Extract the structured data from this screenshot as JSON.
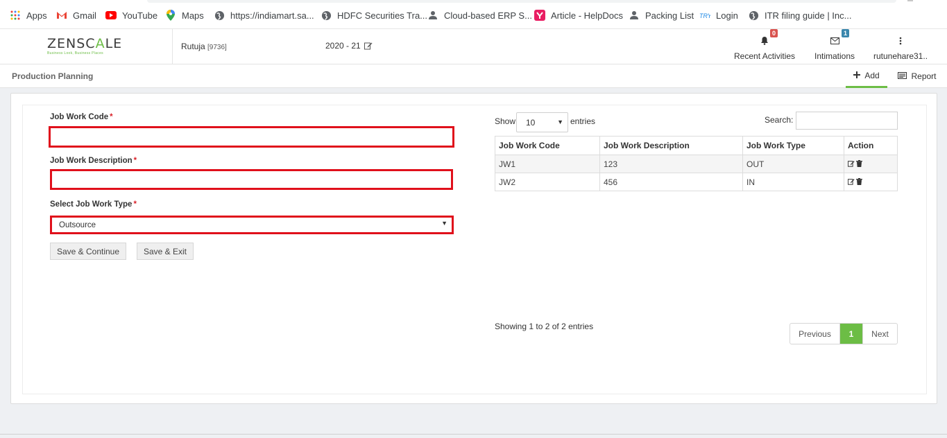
{
  "bookmarks": [
    {
      "label": "Apps",
      "icon": "apps-grid-icon"
    },
    {
      "label": "Gmail",
      "icon": "gmail-icon"
    },
    {
      "label": "YouTube",
      "icon": "youtube-icon"
    },
    {
      "label": "Maps",
      "icon": "maps-icon"
    },
    {
      "label": "https://indiamart.sa...",
      "icon": "globe-icon"
    },
    {
      "label": "HDFC Securities Tra...",
      "icon": "globe-icon"
    },
    {
      "label": "Cloud-based ERP S...",
      "icon": "user-icon"
    },
    {
      "label": "Article - HelpDocs",
      "icon": "helpdocs-icon"
    },
    {
      "label": "Packing List",
      "icon": "user-icon"
    },
    {
      "label": "Login",
      "icon": "tally-icon"
    },
    {
      "label": "ITR filing guide | Inc...",
      "icon": "globe-icon"
    }
  ],
  "header": {
    "logo_text_1": "ZENSC",
    "logo_text_accent": "A",
    "logo_text_2": "LE",
    "logo_tagline": "Business Look, Business Places",
    "user_name": "Rutuja",
    "user_id": "[9736]",
    "fiscal_year": "2020 - 21",
    "recent_activities_label": "Recent Activities",
    "recent_activities_count": "0",
    "intimations_label": "Intimations",
    "intimations_count": "1",
    "account_label": "rutunehare31.."
  },
  "page": {
    "title": "Production Planning",
    "add_tab": "Add",
    "report_tab": "Report"
  },
  "form": {
    "code_label": "Job Work Code",
    "code_value": "",
    "desc_label": "Job Work Description",
    "desc_value": "",
    "type_label": "Select Job Work Type",
    "type_value": "Outsource",
    "required_mark": "*",
    "save_continue": "Save & Continue",
    "save_exit": "Save & Exit"
  },
  "table_controls": {
    "show_label": "Show",
    "page_length": "10",
    "entries_label": "entries",
    "search_label": "Search:",
    "search_value": ""
  },
  "table": {
    "headers": [
      "Job Work Code",
      "Job Work Description",
      "Job Work Type",
      "Action"
    ],
    "rows": [
      {
        "code": "JW1",
        "description": "123",
        "type": "OUT"
      },
      {
        "code": "JW2",
        "description": "456",
        "type": "IN"
      }
    ],
    "info": "Showing 1 to 2 of 2 entries",
    "pager": {
      "previous": "Previous",
      "current": "1",
      "next": "Next"
    }
  },
  "colors": {
    "accent_green": "#6cbd45",
    "error_red": "#e0101b",
    "badge_red": "#d9534f",
    "badge_blue": "#3a87ad"
  }
}
